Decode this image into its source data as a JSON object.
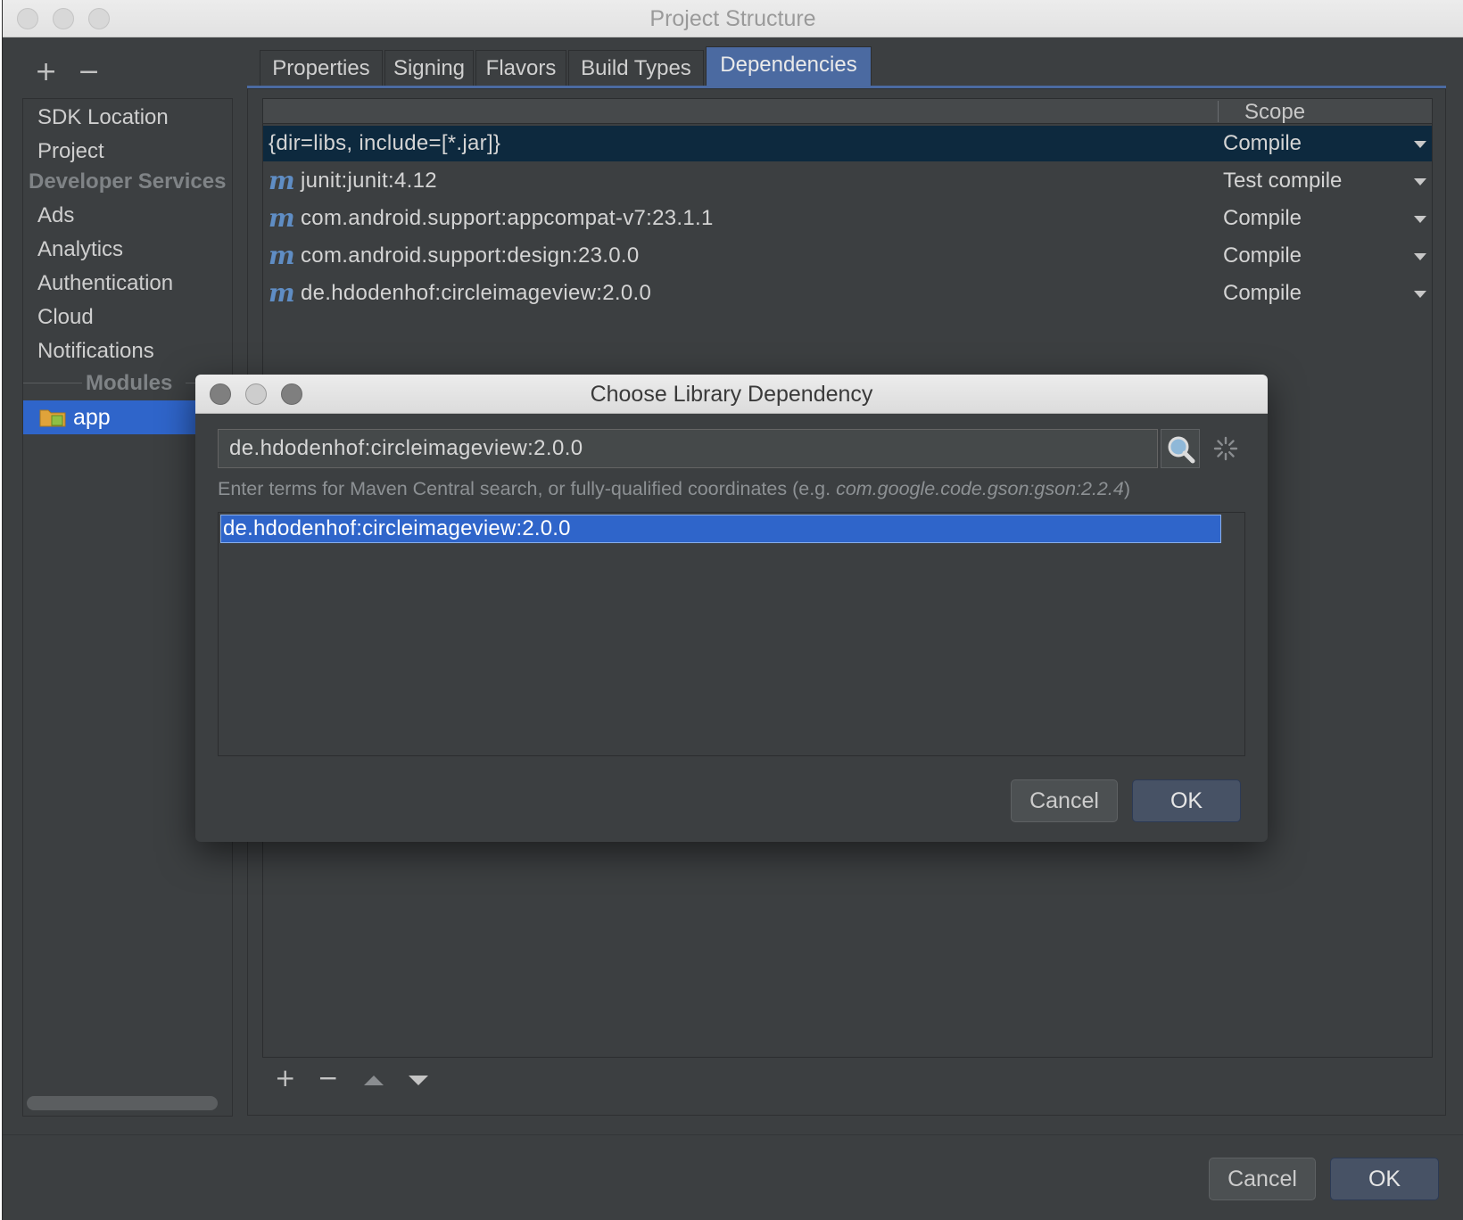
{
  "window": {
    "title": "Project Structure"
  },
  "sidebar": {
    "items": [
      "SDK Location",
      "Project"
    ],
    "developer_services_header": "Developer Services",
    "services": [
      "Ads",
      "Analytics",
      "Authentication",
      "Cloud",
      "Notifications"
    ],
    "modules_header": "Modules",
    "module": "app"
  },
  "tabs": [
    {
      "label": "Properties",
      "active": false
    },
    {
      "label": "Signing",
      "active": false
    },
    {
      "label": "Flavors",
      "active": false
    },
    {
      "label": "Build Types",
      "active": false
    },
    {
      "label": "Dependencies",
      "active": true
    }
  ],
  "dependencies": {
    "scope_header": "Scope",
    "rows": [
      {
        "name": "{dir=libs, include=[*.jar]}",
        "scope": "Compile",
        "icon": "",
        "selected": true
      },
      {
        "name": "junit:junit:4.12",
        "scope": "Test compile",
        "icon": "maven-icon",
        "selected": false
      },
      {
        "name": "com.android.support:appcompat-v7:23.1.1",
        "scope": "Compile",
        "icon": "maven-icon",
        "selected": false
      },
      {
        "name": "com.android.support:design:23.0.0",
        "scope": "Compile",
        "icon": "maven-icon",
        "selected": false
      },
      {
        "name": "de.hdodenhof:circleimageview:2.0.0",
        "scope": "Compile",
        "icon": "maven-icon",
        "selected": false
      }
    ]
  },
  "footer": {
    "cancel_label": "Cancel",
    "ok_label": "OK"
  },
  "dialog": {
    "title": "Choose Library Dependency",
    "search_value": "de.hdodenhof:circleimageview:2.0.0",
    "hint_prefix": "Enter terms for Maven Central search, or fully-qualified coordinates (e.g. ",
    "hint_example": "com.google.code.gson:gson:2.2.4",
    "hint_suffix": ")",
    "results": [
      "de.hdodenhof:circleimageview:2.0.0"
    ],
    "cancel_label": "Cancel",
    "ok_label": "OK"
  },
  "colors": {
    "background": "#3c3f41",
    "selection": "#2f65ca",
    "active_tab": "#4b6aa1",
    "selected_row": "#0d293e"
  }
}
